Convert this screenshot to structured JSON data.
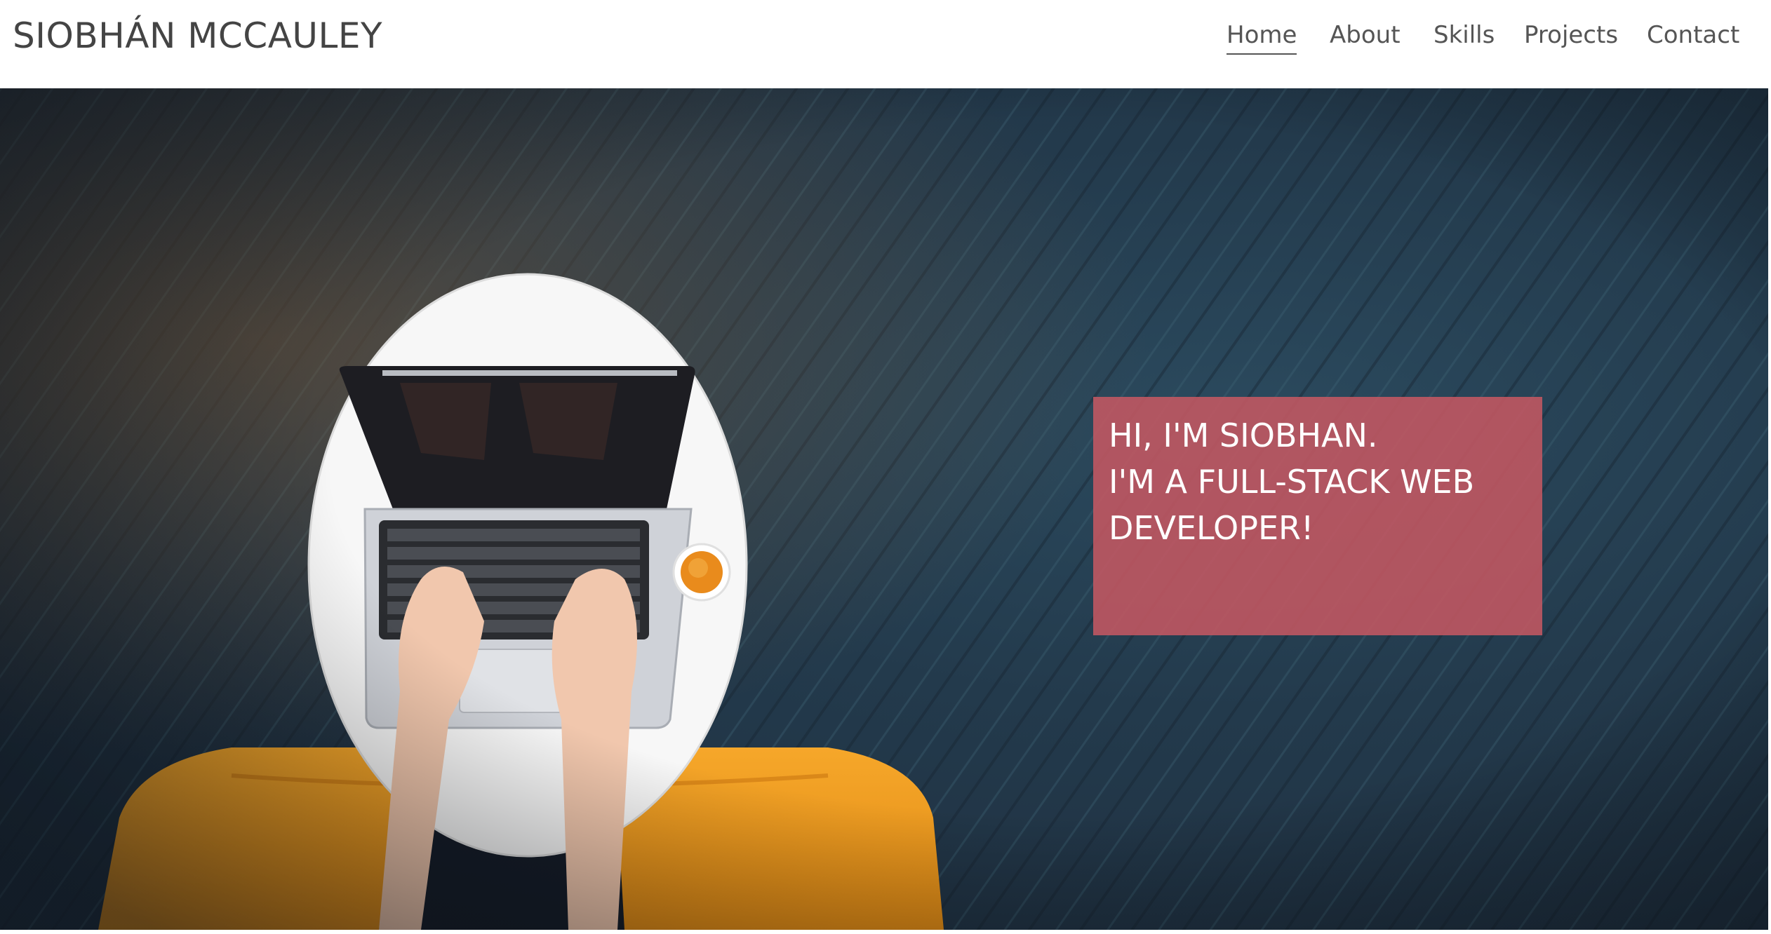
{
  "header": {
    "brand": "SIOBHÁN MCCAULEY",
    "nav": [
      {
        "label": "Home",
        "active": true
      },
      {
        "label": "About",
        "active": false
      },
      {
        "label": "Skills",
        "active": false
      },
      {
        "label": "Projects",
        "active": false
      },
      {
        "label": "Contact",
        "active": false
      }
    ]
  },
  "hero": {
    "photo_description_icon": "laptop-desk-photo",
    "intro_lines": [
      "HI, I'M SIOBHAN.",
      "I'M A FULL-STACK WEB",
      "DEVELOPER!"
    ],
    "box_color": "#c45862"
  }
}
